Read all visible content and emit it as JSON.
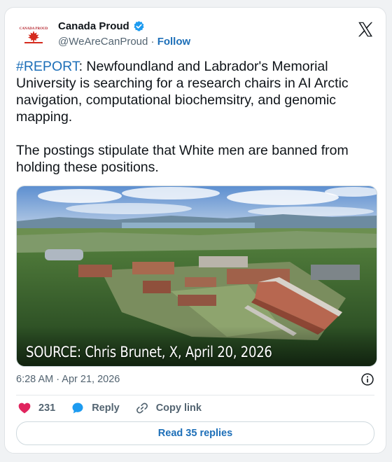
{
  "account": {
    "name": "Canada Proud",
    "handle": "@WeAreCanProud",
    "separator": " · ",
    "follow_label": "Follow",
    "avatar_text": "CANADA PROUD"
  },
  "tweet": {
    "hashtag": "#REPORT",
    "body": ": Newfoundland and Labrador's Memorial University is searching for a research chairs in AI Arctic navigation, computational biochemsitry, and genomic mapping.\n\nThe postings stipulate that White men are banned from holding these positions."
  },
  "media": {
    "caption": "SOURCE: Chris Brunet, X, April 20, 2026"
  },
  "timestamp": "6:28 AM · Apr 21, 2026",
  "actions": {
    "like_count": "231",
    "reply_label": "Reply",
    "copy_label": "Copy link"
  },
  "read_replies_label": "Read 35 replies",
  "colors": {
    "link": "#1d6fb8",
    "like": "#e0245e",
    "reply": "#1d9bf0",
    "secondary_text": "#536471"
  },
  "icons": [
    "verified-badge-icon",
    "x-logo-icon",
    "info-icon",
    "heart-icon",
    "reply-bubble-icon",
    "link-icon"
  ]
}
